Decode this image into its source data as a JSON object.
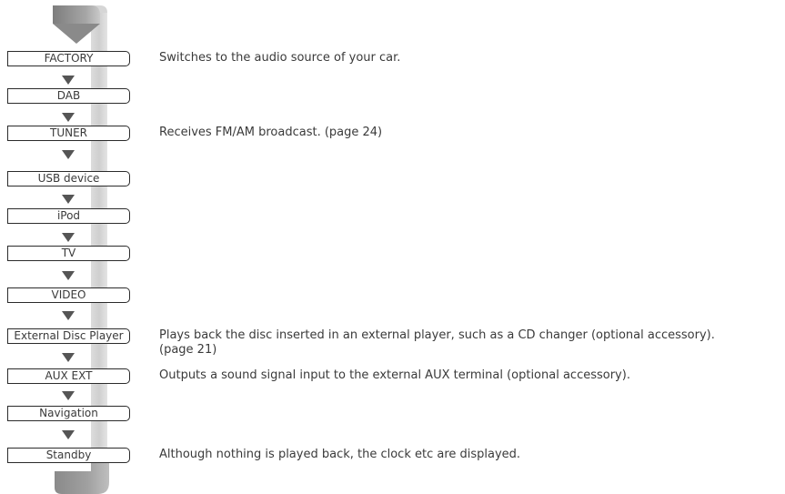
{
  "sources": [
    {
      "label": "FACTORY",
      "description": "Switches to the audio source of your car."
    },
    {
      "label": "DAB",
      "description": ""
    },
    {
      "label": "TUNER",
      "description": "Receives FM/AM broadcast. (page 24)"
    },
    {
      "label": "USB device",
      "description": ""
    },
    {
      "label": "iPod",
      "description": ""
    },
    {
      "label": "TV",
      "description": ""
    },
    {
      "label": "VIDEO",
      "description": ""
    },
    {
      "label": "External Disc Player",
      "description": "Plays back the disc inserted in an external player, such as a CD changer (optional accessory).",
      "description_cont": "(page 21)"
    },
    {
      "label": "AUX EXT",
      "description": "Outputs a sound signal input to the external AUX terminal (optional accessory)."
    },
    {
      "label": "Navigation",
      "description": ""
    },
    {
      "label": "Standby",
      "description": "Although nothing is played back, the clock etc are displayed."
    }
  ],
  "colors": {
    "text": "#3a3a3a",
    "box_border": "#2b2b2b",
    "arrow": "#555555",
    "loop_dark": "#8c8c8c",
    "loop_light": "#d8d8d8"
  },
  "icons": {
    "step_arrow": "triangle-down-icon",
    "loop": "cycle-loop-arrow-icon"
  }
}
